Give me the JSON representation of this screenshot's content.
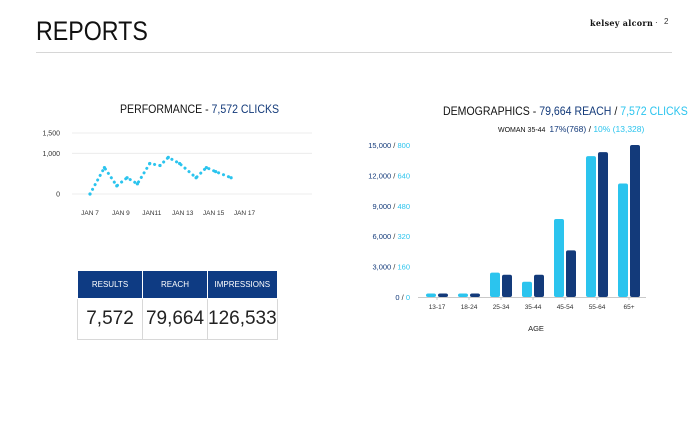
{
  "header": {
    "title": "REPORTS",
    "brand": "kelsey alcorn",
    "separator": "·",
    "page_number": "2"
  },
  "performance": {
    "title_prefix": "PERFORMANCE - ",
    "title_value": "7,572 CLICKS"
  },
  "demographics": {
    "title_prefix": "DEMOGRAPHICS - ",
    "title_reach": "79,664 REACH",
    "title_sep": " / ",
    "title_clicks": "7,572 CLICKS",
    "sub_label": "WOMAN 35-44",
    "sub_reach": "17%(768)",
    "sub_sep": " / ",
    "sub_clicks": "10% (13,328)"
  },
  "stats": {
    "headers": [
      "RESULTS",
      "REACH",
      "IMPRESSIONS"
    ],
    "values": [
      "7,572",
      "79,664",
      "126,533"
    ]
  },
  "colors": {
    "dark": "#133a7a",
    "light": "#2bc4ee",
    "header_bg": "#0e3b83"
  },
  "chart_data": [
    {
      "type": "line",
      "title": "PERFORMANCE - 7,572 CLICKS",
      "x_ticks": [
        "JAN 7",
        "JAN 9",
        "JAN11",
        "JAN 13",
        "JAN 15",
        "JAN 17"
      ],
      "x_tick_index": [
        0,
        3,
        6,
        9,
        12,
        15
      ],
      "y_ticks": [
        "1,500",
        "1,000",
        "0"
      ],
      "y_tick_values": [
        1500,
        1000,
        0
      ],
      "ylim": [
        0,
        1500
      ],
      "line_style": "dotted",
      "series": [
        {
          "values": [
            0,
            650,
            200,
            400,
            250,
            750,
            700,
            900,
            750,
            400,
            650,
            550,
            400
          ]
        }
      ],
      "x_positions": [
        0,
        1.4,
        2.6,
        3.6,
        4.6,
        5.8,
        6.8,
        7.6,
        8.7,
        10.3,
        11.3,
        12.2,
        13.7
      ]
    },
    {
      "type": "bar",
      "title": "DEMOGRAPHICS - 79,664 REACH / 7,572 CLICKS",
      "categories": [
        "13-17",
        "18-24",
        "25-34",
        "35-44",
        "45-54",
        "55-64",
        "65+"
      ],
      "xlabel": "AGE",
      "y_tick_labels_left": [
        "15,000",
        "12,000",
        "9,000",
        "6,000",
        "3,000",
        "0"
      ],
      "y_tick_labels_right": [
        "800",
        "640",
        "480",
        "320",
        "160",
        "0"
      ],
      "y_tick_sep": " / ",
      "ylim": [
        0,
        15000
      ],
      "series": [
        {
          "values": [
            350,
            350,
            2400,
            1500,
            7700,
            13900,
            11200
          ]
        },
        {
          "values": [
            350,
            350,
            2200,
            2200,
            4600,
            14300,
            15000
          ]
        }
      ]
    }
  ]
}
